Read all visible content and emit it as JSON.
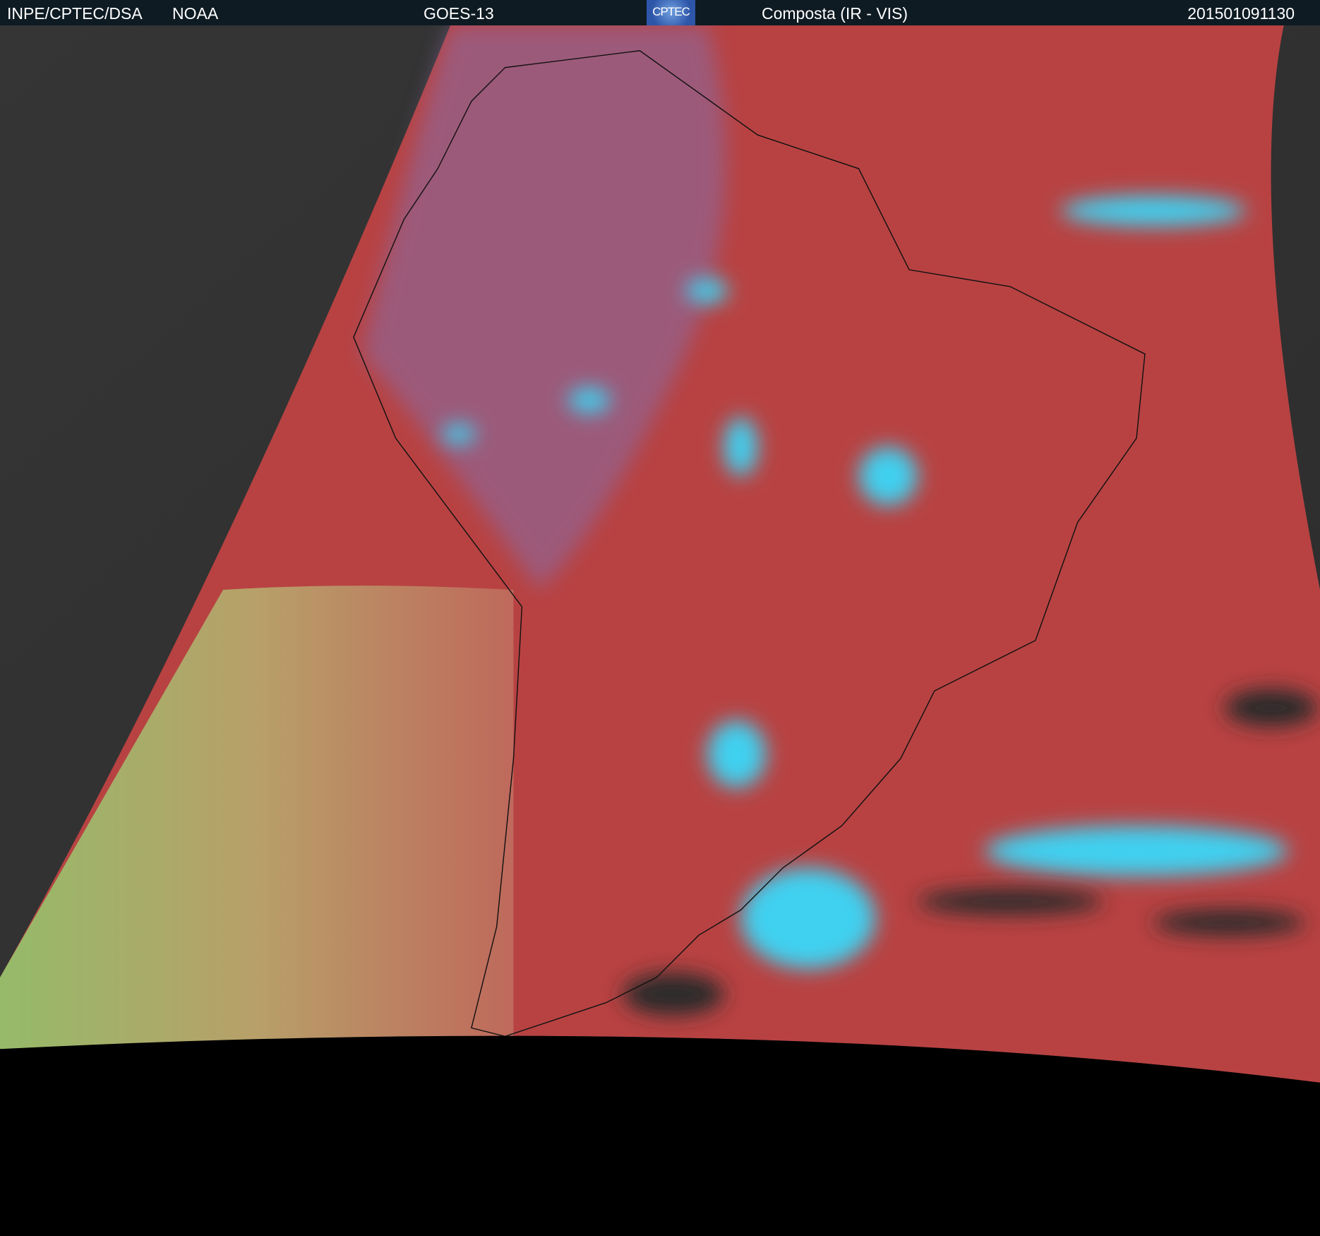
{
  "header": {
    "org": "INPE/CPTEC/DSA",
    "agency": "NOAA",
    "satellite": "GOES-13",
    "logo_text": "CPTEC",
    "product": "Composta (IR - VIS)",
    "timestamp": "201501091130"
  },
  "colors": {
    "header_bg": "#0f1b23",
    "ir_land": "#b84040",
    "cold_cloud": "#3fd0f0",
    "vis_night": "#3a3a3a"
  }
}
